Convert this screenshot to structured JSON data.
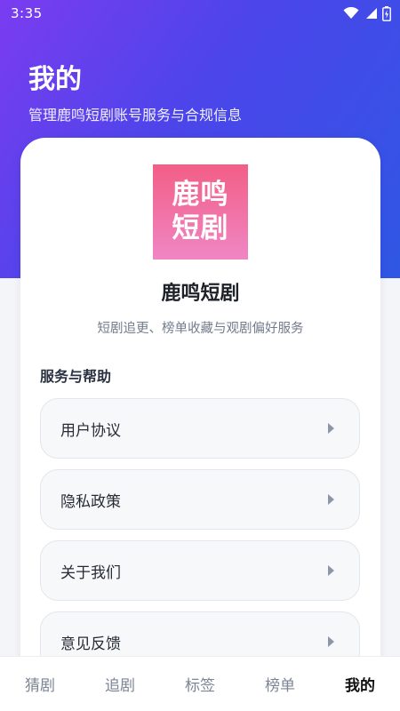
{
  "status_bar": {
    "time": "3:35",
    "icons": [
      "wifi-icon",
      "signal-icon",
      "battery-icon"
    ]
  },
  "header": {
    "title": "我的",
    "subtitle": "管理鹿鸣短剧账号服务与合规信息"
  },
  "app": {
    "logo_line1": "鹿鸣",
    "logo_line2": "短剧",
    "name": "鹿鸣短剧",
    "description": "短剧追更、榜单收藏与观剧偏好服务"
  },
  "services": {
    "title": "服务与帮助",
    "items": [
      {
        "label": "用户协议",
        "icon": "chevron-right-icon"
      },
      {
        "label": "隐私政策",
        "icon": "chevron-right-icon"
      },
      {
        "label": "关于我们",
        "icon": "chevron-right-icon"
      },
      {
        "label": "意见反馈",
        "icon": "chevron-right-icon"
      }
    ]
  },
  "tabs": [
    {
      "label": "猜剧",
      "active": false
    },
    {
      "label": "追剧",
      "active": false
    },
    {
      "label": "标签",
      "active": false
    },
    {
      "label": "榜单",
      "active": false
    },
    {
      "label": "我的",
      "active": true
    }
  ],
  "colors": {
    "hero_start": "#7b3cf0",
    "hero_end": "#2f57e4",
    "logo_top": "#f25e86",
    "logo_bottom": "#f086c4"
  }
}
